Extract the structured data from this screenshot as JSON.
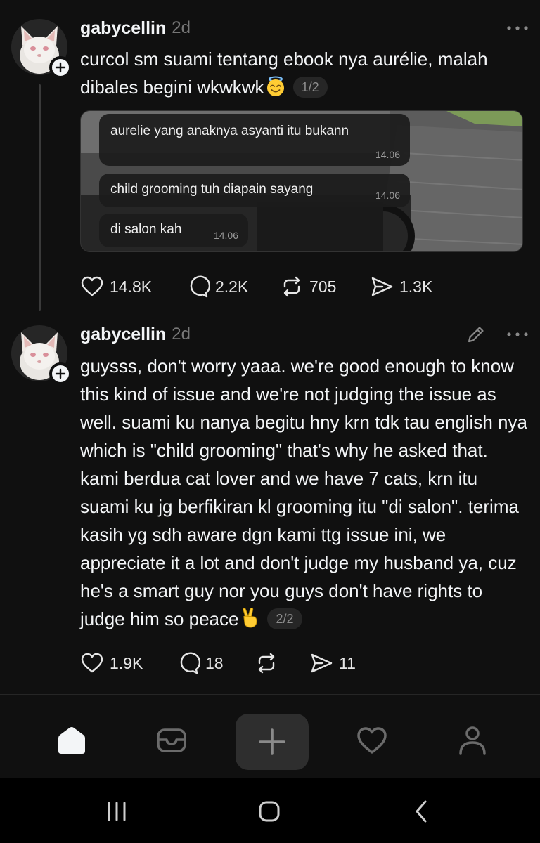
{
  "posts": [
    {
      "username": "gabycellin",
      "time": "2d",
      "text": "curcol sm suami tentang ebook nya aurélie, malah dibales begini wkwkwk",
      "emoji": "smiling-face-with-halo",
      "page": "1/2",
      "media": {
        "messages": [
          {
            "text": "aurelie yang anaknya asyanti itu bukann",
            "time": "14.06"
          },
          {
            "text": "child grooming tuh diapain sayang",
            "time": "14.06"
          },
          {
            "text": "di salon kah",
            "time": "14.06"
          }
        ]
      },
      "stats": {
        "likes": "14.8K",
        "replies": "2.2K",
        "reposts": "705",
        "shares": "1.3K"
      }
    },
    {
      "username": "gabycellin",
      "time": "2d",
      "text": "guysss, don't worry yaaa. we're good enough to know this kind of issue and we're not judging the issue as well. suami ku nanya begitu hny krn tdk tau english nya which is \"child grooming\" that's why he asked that. kami berdua cat lover and we have 7 cats, krn itu suami ku jg berfikiran kl grooming itu \"di salon\". terima kasih yg sdh aware dgn kami ttg issue ini, we appreciate it a lot and don't judge my husband ya, cuz he's a smart guy nor you guys don't have rights to judge him so peace",
      "emoji": "victory-hand",
      "page": "2/2",
      "stats": {
        "likes": "1.9K",
        "replies": "18",
        "reposts": "",
        "shares": "11"
      }
    }
  ],
  "bottom_nav": [
    "home-icon",
    "inbox-icon",
    "compose-plus-icon",
    "heart-icon",
    "profile-icon"
  ],
  "system_nav": [
    "recents-icon",
    "home-icon",
    "back-icon"
  ],
  "colors": {
    "background": "#101010",
    "text": "#f3f5f7",
    "muted": "#777777",
    "compose_bg": "#2e2e2e"
  }
}
